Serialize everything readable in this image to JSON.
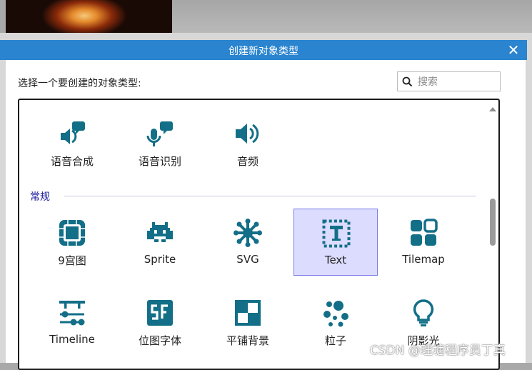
{
  "dialog": {
    "title": "创建新对象类型",
    "close_label": "✕",
    "prompt": "选择一个要创建的对象类型:"
  },
  "search": {
    "placeholder": "搜索",
    "value": ""
  },
  "section": {
    "label": "常规"
  },
  "rows": [
    [
      {
        "label": "语音合成",
        "icon": "speech-synthesis-icon"
      },
      {
        "label": "语音识别",
        "icon": "speech-recognition-icon"
      },
      {
        "label": "音频",
        "icon": "audio-icon"
      }
    ],
    [
      {
        "label": "9宫图",
        "icon": "nine-patch-icon"
      },
      {
        "label": "Sprite",
        "icon": "sprite-icon"
      },
      {
        "label": "SVG",
        "icon": "svg-icon"
      },
      {
        "label": "Text",
        "icon": "text-icon",
        "selected": true
      },
      {
        "label": "Tilemap",
        "icon": "tilemap-icon"
      }
    ],
    [
      {
        "label": "Timeline",
        "icon": "timeline-icon"
      },
      {
        "label": "位图字体",
        "icon": "sprite-font-icon"
      },
      {
        "label": "平铺背景",
        "icon": "tiled-background-icon"
      },
      {
        "label": "粒子",
        "icon": "particles-icon"
      },
      {
        "label": "阴影光",
        "icon": "shadow-light-icon"
      }
    ]
  ],
  "colors": {
    "accent": "#2a84cf",
    "icon": "#136f87",
    "selection": "#dcdcff"
  },
  "watermark": "CSDN @理塘程序员丁真"
}
